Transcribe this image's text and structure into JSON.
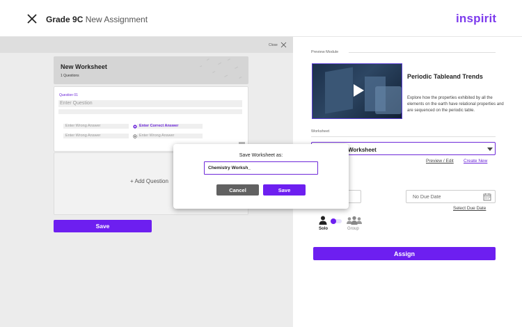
{
  "header": {
    "title_bold": "Grade 9C",
    "title_rest": " New Assignment",
    "brand": "inspirit"
  },
  "editor": {
    "close_label": "Close",
    "worksheet_title": "New Worksheet",
    "worksheet_count": "1 Questions",
    "question": {
      "label": "Question 01",
      "placeholder": "Enter Question",
      "answers": [
        "Enter Wrong Answer",
        "Enter Correct Answer",
        "Enter Wrong Answer",
        "Enter Wrong Answer"
      ],
      "delete_label": "Delete"
    },
    "add_question_label": "+ Add Question",
    "save_label": "Save"
  },
  "assign_panel": {
    "preview_label": "Preview Module",
    "module_title": "Periodic Tableand Trends",
    "module_description": "Explore how the properties exhibited by all the elements on the earth have relational properties and are sequenced on the periodic table.",
    "worksheet_label": "Worksheet",
    "worksheet_selected": "Worksheet",
    "preview_edit_link": "Preview / Edit",
    "create_new_link": "Create New",
    "due_date_placeholder": "No Due Date",
    "select_due_date_link": "Select Due Date",
    "solo_label": "Solo",
    "group_label": "Group",
    "assign_label": "Assign"
  },
  "modal": {
    "title": "Save Worksheet as:",
    "input_value": "Chemistry Worksh_",
    "cancel_label": "Cancel",
    "save_label": "Save"
  },
  "colors": {
    "accent": "#6d1ff0",
    "brand": "#7c3aed",
    "cancel": "#616161",
    "delete": "#e11d48"
  },
  "icons": {
    "header_close": "close-icon",
    "panel_close": "close-icon",
    "play": "play-icon",
    "dropdown": "chevron-down-icon",
    "calendar": "calendar-icon",
    "solo": "person-icon",
    "group": "group-icon",
    "correct_marker": "radio-selected-icon",
    "wrong_marker": "radio-icon"
  }
}
